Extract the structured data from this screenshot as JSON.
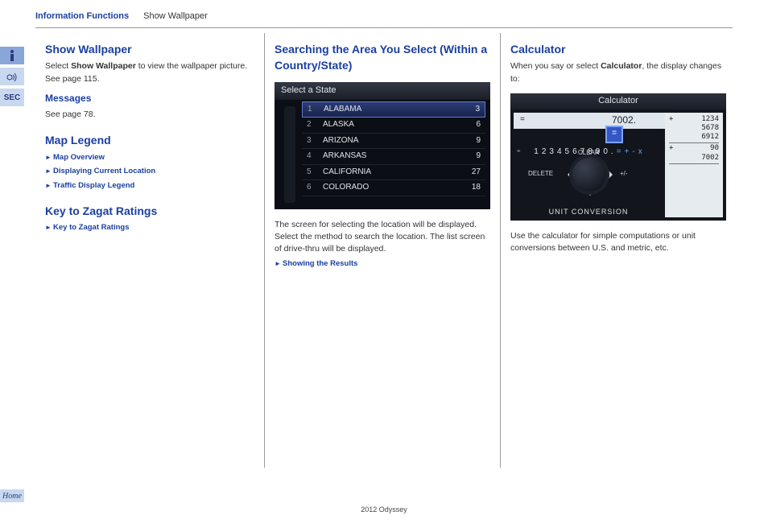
{
  "header": {
    "crumb1": "Information Functions",
    "crumb2": "Show Wallpaper"
  },
  "side": {
    "tab1_aria": "Info",
    "tab2_aria": "Voice",
    "tab3": "SEC",
    "home": "Home"
  },
  "col1": {
    "h2": "Show Wallpaper",
    "p1_prefix": "Select ",
    "p1_bold": "Show Wallpaper",
    "p1_suffix": " to view the wallpaper picture. See page 115.",
    "h3": "Messages",
    "p2": "See page 78.",
    "h2b": "Map Legend",
    "ref1": "Map Overview",
    "ref2": "Displaying Current Location",
    "ref3": "Traffic Display Legend",
    "h2c": "Key to Zagat Ratings",
    "ref4": "Key to Zagat Ratings"
  },
  "col2": {
    "h2": "Searching the Area You Select (Within a Country/State)",
    "shot": {
      "title": "Select a State",
      "rows": [
        {
          "n": "1",
          "name": "ALABAMA",
          "cnt": "3",
          "sel": true
        },
        {
          "n": "2",
          "name": "ALASKA",
          "cnt": "6"
        },
        {
          "n": "3",
          "name": "ARIZONA",
          "cnt": "9"
        },
        {
          "n": "4",
          "name": "ARKANSAS",
          "cnt": "9"
        },
        {
          "n": "5",
          "name": "CALIFORNIA",
          "cnt": "27"
        },
        {
          "n": "6",
          "name": "COLORADO",
          "cnt": "18"
        }
      ]
    },
    "p1": "The screen for selecting the location will be displayed. Select the method to search the location. The list screen of drive-thru will be displayed.",
    "ref": "Showing the Results"
  },
  "col3": {
    "h2": "Calculator",
    "p1_prefix": "When you say or select ",
    "p1_bold": "Calculator",
    "p1_suffix": ", the display changes to:",
    "shot": {
      "title": "Calculator",
      "eq": "=",
      "value": "7002.",
      "digits": [
        "1",
        "2",
        "3",
        "4",
        "5",
        "6",
        "7",
        "8",
        "9",
        "0",
        "."
      ],
      "ops": [
        "=",
        "+",
        "-",
        "x"
      ],
      "divide": "÷",
      "clear": "CLEAR",
      "delete": "DELETE",
      "pm": "+/-",
      "unit": "UNIT CONVERSION",
      "tape": [
        {
          "op": "+",
          "v": "1234"
        },
        {
          "op": "",
          "v": "5678"
        },
        {
          "op": "",
          "v": "6912",
          "line_after": true
        },
        {
          "op": "+",
          "v": "90"
        },
        {
          "op": "",
          "v": "7002",
          "line_after": true
        }
      ]
    },
    "p2": "Use the calculator for simple computations or unit conversions between U.S. and metric, etc."
  },
  "footer": "2012 Odyssey"
}
